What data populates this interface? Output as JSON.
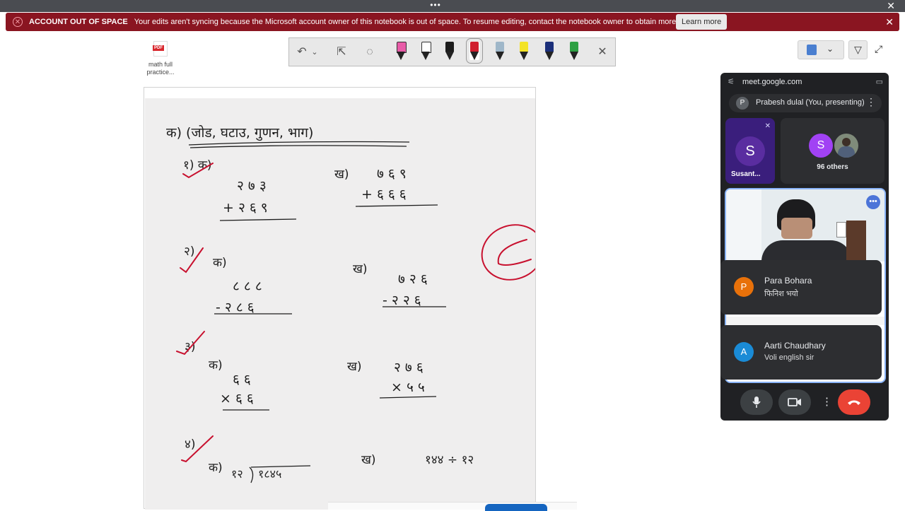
{
  "window": {
    "menu_dots": "•••",
    "close": "✕"
  },
  "banner": {
    "title": "ACCOUNT OUT OF SPACE",
    "message": "Your edits aren't syncing because the Microsoft account owner of this notebook is out of space. To resume editing, contact the notebook owner to obtain more storage.",
    "button": "Learn more",
    "close": "✕",
    "warn_icon": "✕"
  },
  "file": {
    "badge": "PDF",
    "name_line1": "math full",
    "name_line2": "practice..."
  },
  "toolbar": {
    "undo": "↶",
    "chev": "⌄",
    "select": "⇱",
    "lasso": "◌",
    "close": "✕",
    "pens": [
      {
        "name": "pink-highlighter",
        "color": "#e85ca8"
      },
      {
        "name": "black-pen-outline",
        "color": "#ffffff"
      },
      {
        "name": "black-pen",
        "color": "#1c1c1c"
      },
      {
        "name": "red-pen",
        "color": "#d01f2f"
      },
      {
        "name": "galaxy-pen",
        "color": "#9fb7c9"
      },
      {
        "name": "yellow-highlighter",
        "color": "#f3e327"
      },
      {
        "name": "navy-pen",
        "color": "#1b2f7a"
      },
      {
        "name": "green-pen",
        "color": "#2ea043"
      }
    ]
  },
  "right_tools": {
    "chev": "⌄",
    "funnel": "▽",
    "expand": "⤢"
  },
  "meet": {
    "url": "meet.google.com",
    "sliders_icon": "⚟",
    "popout_icon": "▭",
    "presenter_initial": "P",
    "presenter_label": "Prabesh dulal (You, presenting)",
    "more": "⋮",
    "tile1_initial": "S",
    "tile1_name": "Susant...",
    "tile1_mic": "✕",
    "others_initial": "S",
    "others_label": "96 others",
    "video_more": "•••",
    "chats": [
      {
        "initial": "P",
        "color": "#e8710a",
        "name": "Para Bohara",
        "message": "फिनिश भयो"
      },
      {
        "initial": "A",
        "color": "#1a8bd6",
        "name": "Aarti Chaudhary",
        "message": "Voli english sir"
      }
    ],
    "mic_icon": "🎤",
    "cam_icon": "▭",
    "more_icon": "⋮",
    "end_icon": "☎"
  },
  "worksheet": {
    "header": "क) (जोड, घटाउ, गुणन, भाग)",
    "q1_label": "१) क)",
    "q1a_top": "२ ७ ३",
    "q1a_bottom": "+ २ ६ ९",
    "q1b_label": "ख)",
    "q1b_top": "७ ६ ९",
    "q1b_bottom": "+ ६ ६ ६",
    "q2_label": "२)",
    "q2a_label": "क)",
    "q2a_top": "८ ८ ८",
    "q2a_bottom": "- २ ८ ६",
    "q2b_label": "ख)",
    "q2b_top": "७ २ ६",
    "q2b_bottom": "- २ २ ६",
    "q3_label": "३)",
    "q3a_label": "क)",
    "q3a_top": "६ ६",
    "q3a_bottom": "× ६ ६",
    "q3b_label": "ख)",
    "q3b_top": "२ ७ ६",
    "q3b_bottom": "× ५ ५",
    "q4_label": "४)",
    "q4a_label": "क)",
    "q4a_divisor": "१२",
    "q4a_dividend": "१८४५",
    "q4b_label": "ख)",
    "q4b_expr": "१४४ ÷ १२",
    "grade": "E"
  }
}
